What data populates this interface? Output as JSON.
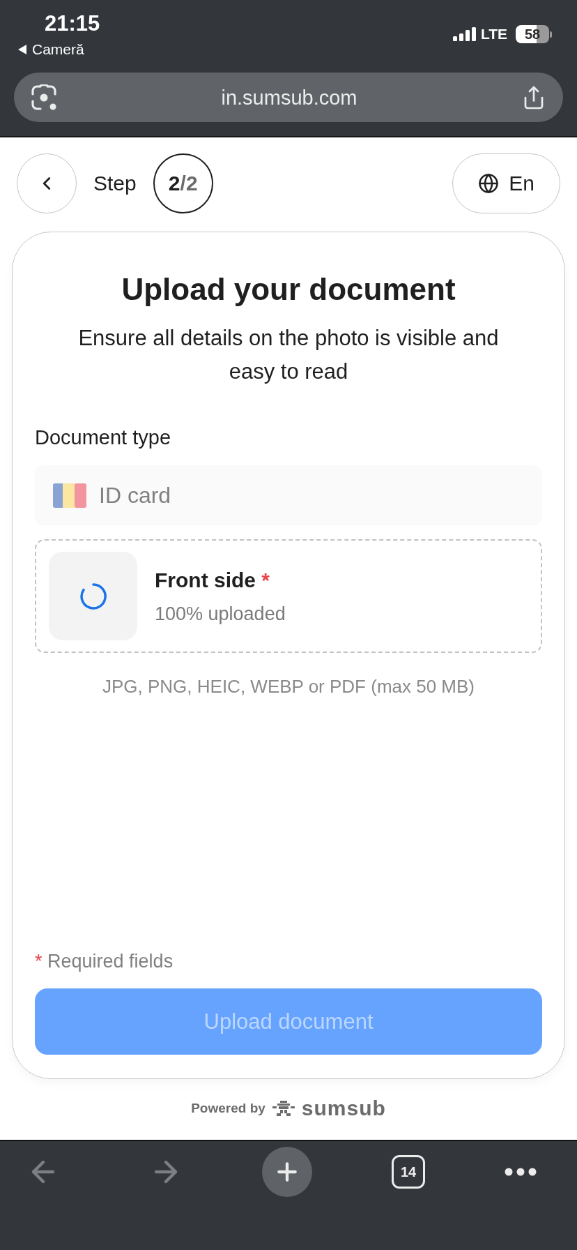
{
  "status_bar": {
    "time": "21:15",
    "back_app": "Cameră",
    "network": "LTE",
    "battery": "58"
  },
  "address_bar": {
    "url": "in.sumsub.com"
  },
  "header": {
    "step": {
      "label": "Step",
      "current": "2",
      "total": "/2"
    },
    "language": {
      "label": "En"
    }
  },
  "card": {
    "title": "Upload your document",
    "subtitle": "Ensure all details on the photo is visible and easy to read",
    "document_type": {
      "label": "Document type",
      "value": "ID card",
      "disabled": true
    },
    "uploads": [
      {
        "title": "Front side",
        "required_mark": "*",
        "status": "100% uploaded",
        "loading": true
      }
    ],
    "hint": "JPG, PNG, HEIC, WEBP or PDF (max 50 MB)",
    "required_note": {
      "mark": "*",
      "text": "Required fields"
    },
    "submit": {
      "label": "Upload document",
      "disabled": true
    }
  },
  "footer": {
    "powered_by": "Powered by",
    "brand": "sumsub"
  },
  "toolbar": {
    "back": {
      "disabled": true
    },
    "forward": {
      "disabled": true
    },
    "tab_count": "14"
  }
}
